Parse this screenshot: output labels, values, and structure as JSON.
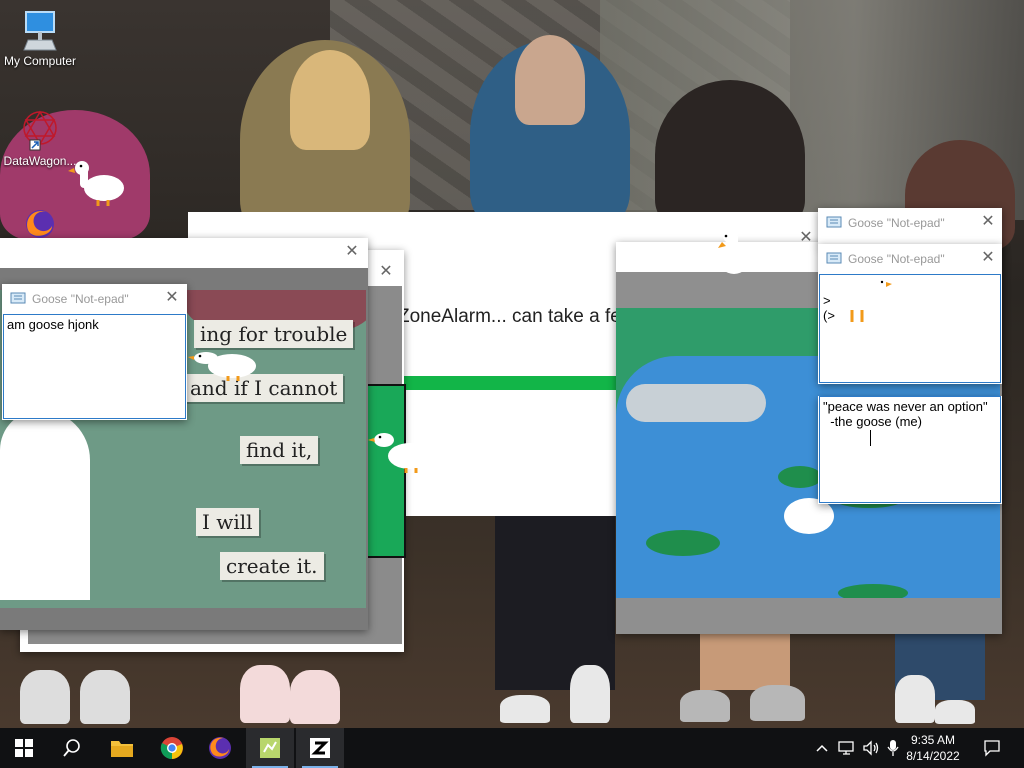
{
  "desktop": {
    "icons": [
      {
        "label": "My Computer",
        "icon": "computer-icon"
      },
      {
        "label": "DataWagon...",
        "icon": "datawagon-icon"
      }
    ]
  },
  "zonealarm_window": {
    "text": "ZoneAlarm... can take a fe",
    "accent": "#12b548"
  },
  "meme_window": {
    "words": [
      "ing for trouble",
      "and if I cannot",
      "find it,",
      "I will",
      "create it."
    ],
    "colors": {
      "background": "#6e9a86",
      "paper": "#ecebe4"
    }
  },
  "notepads": [
    {
      "title": "Goose \"Not-epad\"",
      "text": "am goose hjonk"
    },
    {
      "title": "Goose \"Not-epad\"",
      "text": ""
    },
    {
      "title": "Goose \"Not-epad\"",
      "text": ">\n(>"
    },
    {
      "title": "",
      "text": "\"peace was never an option\"\n  -the goose (me)"
    }
  ],
  "pond_window": {
    "colors": {
      "water": "#3d8fd6",
      "grass": "#2f9c6a",
      "lilypad": "#1f8e4c"
    }
  },
  "taskbar": {
    "apps": [
      {
        "name": "start",
        "icon": "windows-logo-icon"
      },
      {
        "name": "search",
        "icon": "search-icon"
      },
      {
        "name": "file-explorer",
        "icon": "folder-icon"
      },
      {
        "name": "chrome",
        "icon": "chrome-icon"
      },
      {
        "name": "firefox",
        "icon": "firefox-icon"
      },
      {
        "name": "goose",
        "icon": "goose-app-icon"
      },
      {
        "name": "zonealarm",
        "icon": "zonealarm-icon"
      }
    ],
    "clock": {
      "time": "9:35 AM",
      "date": "8/14/2022"
    },
    "tray_icons": [
      "chevron-up-icon",
      "network-icon",
      "volume-icon",
      "microphone-icon",
      "notifications-icon"
    ]
  }
}
